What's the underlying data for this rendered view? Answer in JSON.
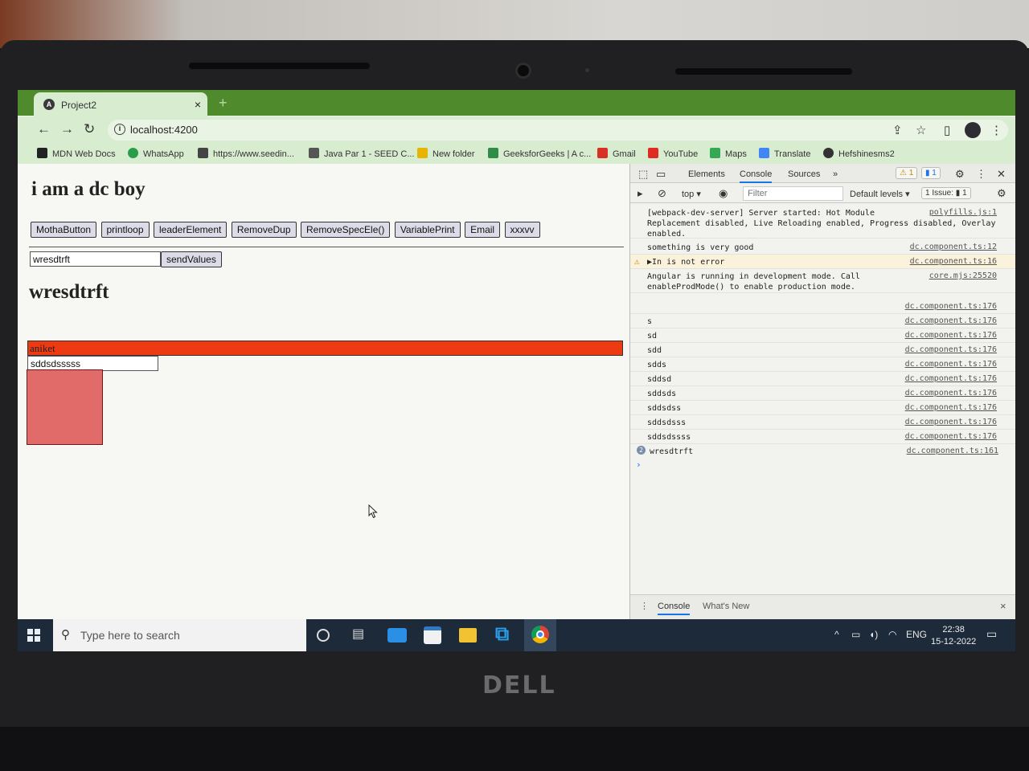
{
  "browser": {
    "tab_title": "Project2",
    "tab_icon_letter": "A",
    "tab_close": "×",
    "new_tab": "+",
    "url": "localhost:4200"
  },
  "bookmarks": [
    {
      "label": "MDN Web Docs",
      "color": "#222222"
    },
    {
      "label": "WhatsApp",
      "color": "#2a9d4a"
    },
    {
      "label": "https://www.seedin...",
      "color": "#444444"
    },
    {
      "label": "Java Par 1 - SEED C...",
      "color": "#555555"
    },
    {
      "label": "New folder",
      "color": "#e7b400"
    },
    {
      "label": "GeeksforGeeks | A c...",
      "color": "#2f8d46"
    },
    {
      "label": "Gmail",
      "color": "#d93025"
    },
    {
      "label": "YouTube",
      "color": "#e02b20"
    },
    {
      "label": "Maps",
      "color": "#34a853"
    },
    {
      "label": "Translate",
      "color": "#4285f4"
    },
    {
      "label": "Hefshinesms2",
      "color": "#333333"
    }
  ],
  "page": {
    "heading": "i am a dc boy",
    "buttons": [
      "MothaButton",
      "printloop",
      "leaderElement",
      "RemoveDup",
      "RemoveSpecEle()",
      "VariablePrint",
      "Email",
      "xxxvv"
    ],
    "input_value": "wresdtrft",
    "send_label": "sendValues",
    "echo_heading": "wresdtrft",
    "red_bar_text": "aniket",
    "second_input_value": "sddsdsssss",
    "red_bar_color": "#ee3a12",
    "box_color": "#e06b69"
  },
  "devtools": {
    "tabs": [
      "Elements",
      "Console",
      "Sources",
      "»"
    ],
    "warning_badge": "⚠ 1",
    "message_badge": "▮ 1",
    "context": "top ▾",
    "filter_placeholder": "Filter",
    "levels": "Default levels ▾",
    "issues": "1 Issue: ▮ 1",
    "console": [
      {
        "msg": "[webpack-dev-server] Server started: Hot Module\nReplacement disabled, Live Reloading enabled, Progress disabled, Overlay\nenabled.",
        "src": "polyfills.js:1",
        "kind": "log"
      },
      {
        "msg": "something is very good",
        "src": "dc.component.ts:12",
        "kind": "log"
      },
      {
        "msg": "▶In is not error",
        "src": "dc.component.ts:16",
        "kind": "warn"
      },
      {
        "msg": "Angular is running in development mode. Call\nenableProdMode() to enable production mode.",
        "src": "core.mjs:25520",
        "kind": "log"
      },
      {
        "msg": "",
        "src": "dc.component.ts:176",
        "kind": "log"
      },
      {
        "msg": "s",
        "src": "dc.component.ts:176",
        "kind": "log"
      },
      {
        "msg": "sd",
        "src": "dc.component.ts:176",
        "kind": "log"
      },
      {
        "msg": "sdd",
        "src": "dc.component.ts:176",
        "kind": "log"
      },
      {
        "msg": "sdds",
        "src": "dc.component.ts:176",
        "kind": "log"
      },
      {
        "msg": "sddsd",
        "src": "dc.component.ts:176",
        "kind": "log"
      },
      {
        "msg": "sddsds",
        "src": "dc.component.ts:176",
        "kind": "log"
      },
      {
        "msg": "sddsdss",
        "src": "dc.component.ts:176",
        "kind": "log"
      },
      {
        "msg": "sddsdsss",
        "src": "dc.component.ts:176",
        "kind": "log"
      },
      {
        "msg": "sddsdssss",
        "src": "dc.component.ts:176",
        "kind": "log"
      },
      {
        "msg": "wresdtrft",
        "src": "dc.component.ts:161",
        "kind": "count",
        "count": "2"
      }
    ],
    "prompt": "›",
    "drawer_tabs": [
      "Console",
      "What's New"
    ],
    "drawer_close": "×"
  },
  "taskbar": {
    "search_placeholder": "Type here to search",
    "lang": "ENG",
    "time": "22:38",
    "date": "15-12-2022"
  },
  "hardware": {
    "brand": "DELL"
  }
}
